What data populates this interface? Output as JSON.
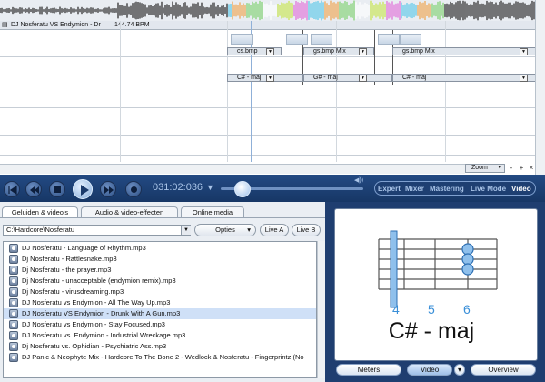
{
  "timeline": {
    "track_title": "DJ Nosferatu VS Endymion - Dr",
    "bpm": "144.74 BPM",
    "clips_top": [
      "cs.bmp",
      "gs.bmp Mix",
      "gs.bmp Mix"
    ],
    "clips_bottom": [
      "C# - maj",
      "G# - maj",
      "C# - maj"
    ],
    "zoom_label": "Zoom",
    "zoom_minus": "-",
    "zoom_plus": "+",
    "close_label": "×"
  },
  "transport": {
    "time": "031:02:036",
    "modes": [
      {
        "label": "Expert",
        "active": false
      },
      {
        "label": "Mixer",
        "active": false
      },
      {
        "label": "Mastering",
        "active": false
      },
      {
        "label": "Live Mode",
        "active": false
      },
      {
        "label": "Video",
        "active": true
      }
    ]
  },
  "library": {
    "tabs": [
      "Geluiden & video's",
      "Audio & video-effecten",
      "Online media"
    ],
    "path": "C:\\Hardcore\\Nosferatu",
    "options_label": "Opties",
    "live_a": "Live A",
    "live_b": "Live B",
    "files": [
      "DJ Nosferatu - Language of Rhythm.mp3",
      "Dj Nosferatu - Rattlesnake.mp3",
      "Dj Nosferatu - the prayer.mp3",
      "Dj Nosferatu - unacceptable (endymion remix).mp3",
      "Dj Nosferatu - virusdreaming.mp3",
      "DJ Nosferatu vs Endymion - All The Way Up.mp3",
      "DJ Nosferatu VS Endymion - Drunk With A Gun.mp3",
      "DJ Nosferatu vs Endymion - Stay Focused.mp3",
      "DJ Nosferatu vs. Endymion - Industrial Wreckage.mp3",
      "Dj Nosferatu vs. Ophidian - Psychiatric Ass.mp3",
      "DJ Panic & Neophyte Mix - Hardcore To The Bone 2 - Wedlock & Nosferatu - Fingerprintz (No"
    ],
    "selected_index": 6
  },
  "video_panel": {
    "chord": "C# - maj",
    "frets": [
      "4",
      "5",
      "6"
    ],
    "buttons": [
      "Meters",
      "Video",
      "Overview"
    ],
    "active_button": "Video"
  },
  "colors": {
    "accent_blue": "#1f3e70",
    "selection": "#cfe0f7",
    "fret_highlight": "#3a8fd8"
  }
}
